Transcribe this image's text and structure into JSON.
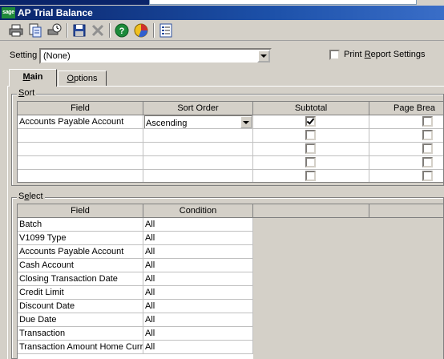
{
  "window": {
    "title": "AP Trial Balance",
    "logo_text": "sage"
  },
  "toolbar": {
    "buttons": [
      "print-icon",
      "print-preview-icon",
      "schedule-icon",
      "save-icon",
      "delete-icon",
      "help-icon",
      "chart-icon",
      "settings-list-icon"
    ]
  },
  "setting": {
    "label": "Setting",
    "value": "(None)"
  },
  "print_report_settings": {
    "label": "Print Report Settings",
    "checked": false
  },
  "tabs": [
    {
      "label": "Main",
      "active": true
    },
    {
      "label": "Options",
      "active": false
    }
  ],
  "sort": {
    "title": "Sort",
    "headers": [
      "Field",
      "Sort Order",
      "Subtotal",
      "Page Brea"
    ],
    "rows": [
      {
        "field": "Accounts Payable Account",
        "order": "Ascending",
        "subtotal": true,
        "page_break": false
      },
      {
        "field": "",
        "order": "",
        "subtotal": false,
        "page_break": false
      },
      {
        "field": "",
        "order": "",
        "subtotal": false,
        "page_break": false
      },
      {
        "field": "",
        "order": "",
        "subtotal": false,
        "page_break": false
      },
      {
        "field": "",
        "order": "",
        "subtotal": false,
        "page_break": false
      }
    ]
  },
  "select": {
    "title": "Select",
    "headers": [
      "Field",
      "Condition"
    ],
    "rows": [
      {
        "field": "Batch",
        "condition": "All"
      },
      {
        "field": "V1099 Type",
        "condition": "All"
      },
      {
        "field": "Accounts Payable Account",
        "condition": "All"
      },
      {
        "field": "Cash Account",
        "condition": "All"
      },
      {
        "field": "Closing Transaction Date",
        "condition": "All"
      },
      {
        "field": "Credit Limit",
        "condition": "All"
      },
      {
        "field": "Discount Date",
        "condition": "All"
      },
      {
        "field": "Due Date",
        "condition": "All"
      },
      {
        "field": "Transaction",
        "condition": "All"
      },
      {
        "field": "Transaction Amount Home Curre",
        "condition": "All"
      }
    ]
  }
}
